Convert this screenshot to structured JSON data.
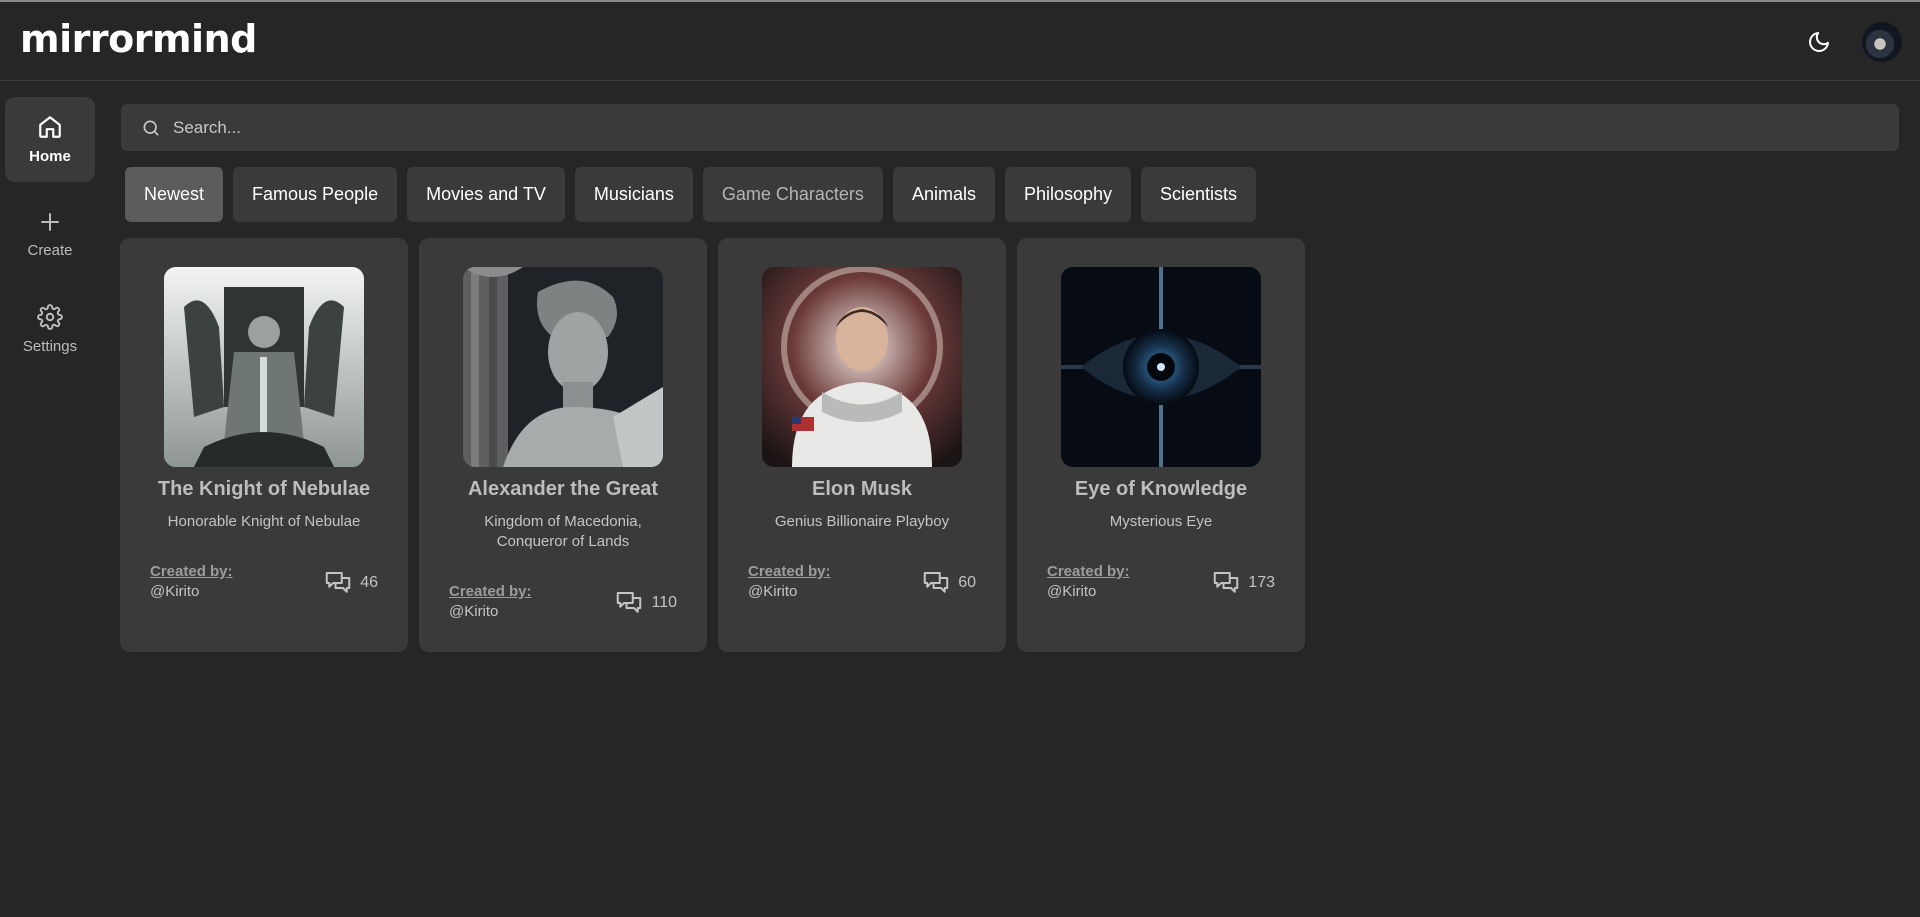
{
  "app": {
    "logo": "mirrormind"
  },
  "header": {
    "theme_icon": "moon-icon",
    "avatar_icon": "avatar"
  },
  "sidebar": {
    "items": [
      {
        "label": "Home",
        "icon": "home-icon",
        "active": true
      },
      {
        "label": "Create",
        "icon": "plus-icon",
        "active": false
      },
      {
        "label": "Settings",
        "icon": "gear-icon",
        "active": false
      }
    ]
  },
  "search": {
    "placeholder": "Search...",
    "value": ""
  },
  "categories": [
    {
      "label": "Newest",
      "active": true
    },
    {
      "label": "Famous People"
    },
    {
      "label": "Movies and TV"
    },
    {
      "label": "Musicians"
    },
    {
      "label": "Game Characters"
    },
    {
      "label": "Animals"
    },
    {
      "label": "Philosophy"
    },
    {
      "label": "Scientists"
    }
  ],
  "cards": [
    {
      "title": "The Knight of Nebulae",
      "subtitle": "Honorable Knight of Nebulae",
      "created_by_label": "Created by:",
      "creator": "@Kirito",
      "message_count": "46"
    },
    {
      "title": "Alexander the Great",
      "subtitle": "Kingdom of Macedonia, Conqueror of Lands",
      "created_by_label": "Created by:",
      "creator": "@Kirito",
      "message_count": "110"
    },
    {
      "title": "Elon Musk",
      "subtitle": "Genius Billionaire Playboy",
      "created_by_label": "Created by:",
      "creator": "@Kirito",
      "message_count": "60"
    },
    {
      "title": "Eye of Knowledge",
      "subtitle": "Mysterious Eye",
      "created_by_label": "Created by:",
      "creator": "@Kirito",
      "message_count": "173"
    }
  ],
  "colors": {
    "background": "#262626",
    "surface": "#3a3a3a",
    "active_chip": "#5c5c5c"
  }
}
